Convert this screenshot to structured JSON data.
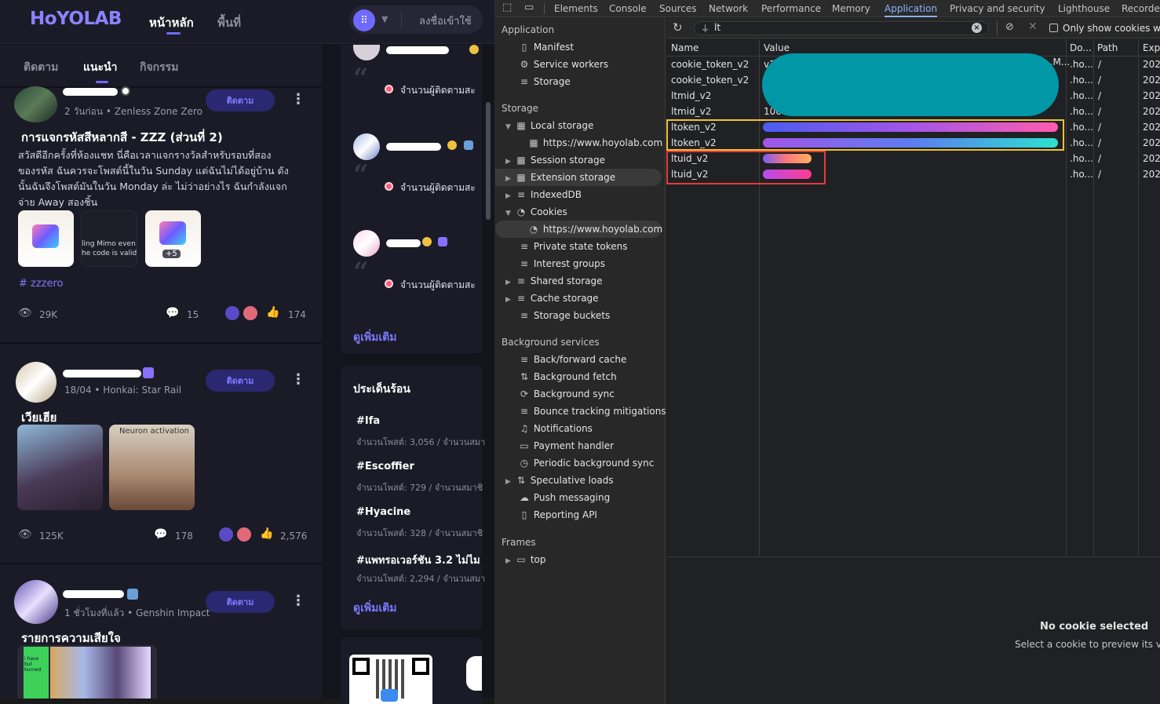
{
  "hoyolab": {
    "logo": "HoYOLAB",
    "nav": [
      "หน้าหลัก",
      "พื้นที่"
    ],
    "login": "ลงชื่อเข้าใช้",
    "feed_tabs": [
      "ติดตาม",
      "แนะนำ",
      "กิจกรรม"
    ],
    "follow_label": "ติดตาม",
    "posts": [
      {
        "meta": "2 วันก่อน • Zenless Zone Zero",
        "title": "การแจกรหัสสีหลากสี - ZZZ (ส่วนที่ 2)",
        "body": [
          "สวัสดีอีกครั้งที่ห้องแชท นี่คือเวลาแจกรางวัลสำหรับรอบที่สอง",
          "ของรหัส ฉันควรจะโพสต์นี้ในวัน Sunday แต่ฉันไม่ได้อยู่บ้าน ดัง",
          "นั้นฉันจึงโพสต์มันในวัน Monday ล่ะ ไม่ว่าอย่างไร ฉันกำลังแจก",
          "จ่าย Away สองชิ้น"
        ],
        "thumb_caption": [
          "ling Mimo even",
          "he code is valid"
        ],
        "thumb_more": "+5",
        "tag": "zzzero",
        "views": "29K",
        "comments": "15",
        "likes": "174"
      },
      {
        "meta": "18/04 • Honkai: Star Rail",
        "title": "เวียเฮีย",
        "thumb_caption": "Neuron activation",
        "views": "125K",
        "comments": "178",
        "likes": "2,576"
      },
      {
        "meta": "1 ชั่วโมงที่แล้ว • Genshin Impact",
        "title": "รายการความเสียใจ",
        "thumb_note": "i have but burned"
      }
    ],
    "sidebar": {
      "followers_text": "จำนวนผู้ติดตามสะ",
      "see_more": "ดูเพิ่มเติม",
      "hot_title": "ประเด็นร้อน",
      "hot": [
        {
          "tag": "#Ifa",
          "stats": "จำนวนโพสต์: 3,056 / จำนวนสมา"
        },
        {
          "tag": "#Escoffier",
          "stats": "จำนวนโพสต์: 729 / จำนวนสมาชิ"
        },
        {
          "tag": "#Hyacine",
          "stats": "จำนวนโพสต์: 328 / จำนวนสมาชิ"
        },
        {
          "tag": "#แพทรอเวอร์ชัน 3.2 ไม่ไม",
          "stats": "จำนวนโพสต์: 2,294 / จำนวนสมา"
        }
      ]
    }
  },
  "devtools": {
    "tabs": [
      "Elements",
      "Console",
      "Sources",
      "Network",
      "Performance",
      "Memory",
      "Application",
      "Privacy and security",
      "Lighthouse",
      "Recorder"
    ],
    "active_tab": "Application",
    "tree": {
      "application_header": "Application",
      "application_items": [
        "Manifest",
        "Service workers",
        "Storage"
      ],
      "storage_header": "Storage",
      "local_storage": "Local storage",
      "local_origin": "https://www.hoyolab.com",
      "session_storage": "Session storage",
      "extension_storage": "Extension storage",
      "indexeddb": "IndexedDB",
      "cookies": "Cookies",
      "cookies_origin": "https://www.hoyolab.com",
      "more_storage": [
        "Private state tokens",
        "Interest groups",
        "Shared storage",
        "Cache storage",
        "Storage buckets"
      ],
      "bg_header": "Background services",
      "bg_items": [
        "Back/forward cache",
        "Background fetch",
        "Background sync",
        "Bounce tracking mitigations",
        "Notifications",
        "Payment handler",
        "Periodic background sync",
        "Speculative loads",
        "Push messaging",
        "Reporting API"
      ],
      "frames_header": "Frames",
      "frames_top": "top"
    },
    "filter_value": "lt",
    "only_cookies_label": "Only show cookies with",
    "columns": [
      "Name",
      "Value",
      "Do...",
      "Path",
      "Expi"
    ],
    "rows": [
      {
        "name": "cookie_token_v2",
        "value": "v2",
        "domain": ".ho...",
        "path": "/",
        "exp": "202"
      },
      {
        "name": "cookie_token_v2",
        "value": "",
        "domain": ".ho...",
        "path": "/",
        "exp": "202"
      },
      {
        "name": "ltmid_v2",
        "value": "",
        "domain": ".ho...",
        "path": "/",
        "exp": "202"
      },
      {
        "name": "ltmid_v2",
        "value": "100",
        "domain": ".ho...",
        "path": "/",
        "exp": "202"
      },
      {
        "name": "ltoken_v2",
        "value": "",
        "domain": ".ho...",
        "path": "/",
        "exp": "202"
      },
      {
        "name": "ltoken_v2",
        "value": "",
        "domain": ".ho...",
        "path": "/",
        "exp": "202"
      },
      {
        "name": "ltuid_v2",
        "value": "",
        "domain": ".ho...",
        "path": "/",
        "exp": "202"
      },
      {
        "name": "ltuid_v2",
        "value": "",
        "domain": ".ho...",
        "path": "/",
        "exp": "202"
      }
    ],
    "row0_trunc": "...M...",
    "preview_title": "No cookie selected",
    "preview_sub": "Select a cookie to preview its value"
  }
}
